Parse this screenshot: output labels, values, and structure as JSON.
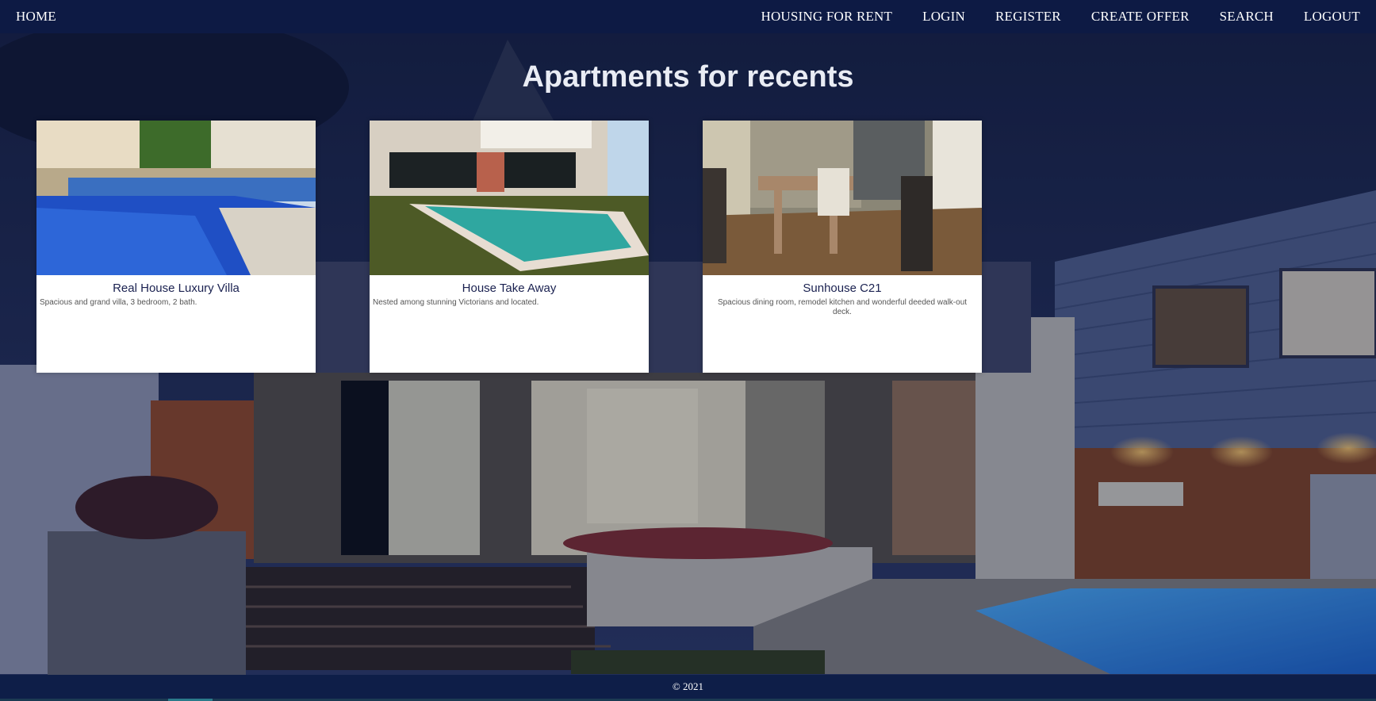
{
  "nav": {
    "home": "HOME",
    "items": [
      "HOUSING FOR RENT",
      "LOGIN",
      "REGISTER",
      "CREATE OFFER",
      "SEARCH",
      "LOGOUT"
    ]
  },
  "main": {
    "title": "Apartments for recents",
    "cards": [
      {
        "title": "Real House Luxury Villa",
        "description": "Spacious and grand villa, 3 bedroom, 2 bath."
      },
      {
        "title": "House Take Away",
        "description": "Nested among stunning Victorians and located."
      },
      {
        "title": "Sunhouse C21",
        "description": "Spacious dining room, remodel kitchen and wonderful deeded walk-out deck."
      }
    ]
  },
  "footer": {
    "copyright": "© 2021"
  },
  "colors": {
    "nav": "#0d1a44",
    "footer": "#0e1e48",
    "title": "#e9ecf4",
    "card_title": "#1a2150"
  }
}
